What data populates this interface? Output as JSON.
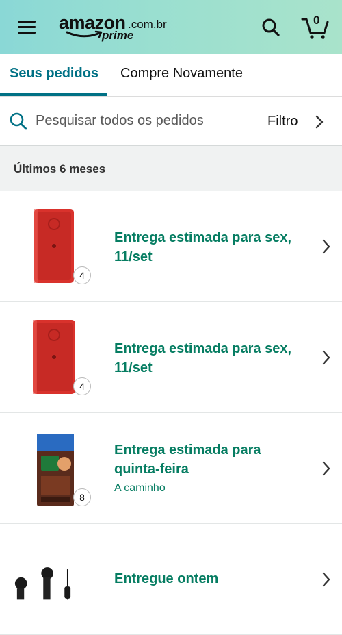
{
  "header": {
    "logo_word": "amazon",
    "logo_tld": ".com.br",
    "logo_sub": "prime",
    "cart_count": "0"
  },
  "tabs": [
    {
      "label": "Seus pedidos",
      "active": true
    },
    {
      "label": "Compre Novamente",
      "active": false
    }
  ],
  "search": {
    "placeholder": "Pesquisar todos os pedidos",
    "filter_label": "Filtro"
  },
  "section": {
    "title": "Últimos 6 meses"
  },
  "orders": [
    {
      "status": "Entrega estimada para sex, 11/set",
      "sub": "",
      "qty": "4",
      "item": "red-ice-pack"
    },
    {
      "status": "Entrega estimada para sex, 11/set",
      "sub": "",
      "qty": "4",
      "item": "red-ice-pack"
    },
    {
      "status": "Entrega estimada para quinta-feira",
      "sub": "A caminho",
      "qty": "8",
      "item": "chocolate-milk-box"
    },
    {
      "status": "Entregue ontem",
      "sub": "",
      "qty": "",
      "item": "earphones"
    }
  ],
  "colors": {
    "header_gradient_start": "#8ad8d6",
    "header_gradient_end": "#a9e3cb",
    "accent_teal": "#007185",
    "status_green": "#067D62"
  },
  "icons": [
    "menu-icon",
    "search-icon",
    "cart-icon",
    "chevron-right-icon"
  ]
}
